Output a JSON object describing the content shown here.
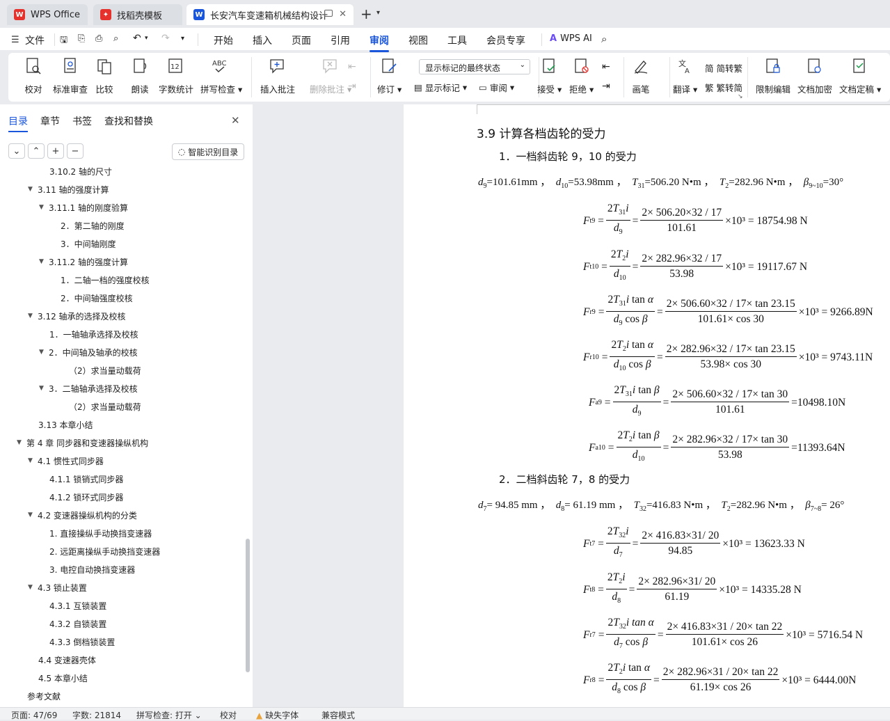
{
  "tabs": [
    {
      "label": "WPS Office",
      "active": false
    },
    {
      "label": "找稻壳模板",
      "active": false
    },
    {
      "label": "长安汽车变速箱机械结构设计",
      "active": true
    }
  ],
  "menu": {
    "file": "文件",
    "items": [
      "开始",
      "插入",
      "页面",
      "引用",
      "审阅",
      "视图",
      "工具",
      "会员专享"
    ],
    "active": "审阅",
    "wps_ai": "WPS AI"
  },
  "ribbon": {
    "proof": "校对",
    "std_review": "标准审查",
    "compare": "比较",
    "read_aloud": "朗读",
    "word_count": "字数统计",
    "spell_check": "拼写检查",
    "insert_comment": "插入批注",
    "delete_comment": "删除批注",
    "track": "修订",
    "display_dropdown": "显示标记的最终状态",
    "show_markup": "显示标记",
    "review": "审阅",
    "accept": "接受",
    "reject": "拒绝",
    "pen": "画笔",
    "translate": "翻译",
    "to_trad": "简转繁",
    "to_simp": "繁转简",
    "restrict": "限制编辑",
    "encrypt": "文档加密",
    "finalize": "文档定稿"
  },
  "sidebar": {
    "tabs": [
      "目录",
      "章节",
      "书签",
      "查找和替换"
    ],
    "active": "目录",
    "ai_toc": "智能识别目录",
    "toc": [
      {
        "t": "3.10.2 轴的尺寸",
        "lvl": 3,
        "caret": ""
      },
      {
        "t": "3.11 轴的强度计算",
        "lvl": 2,
        "caret": "▼"
      },
      {
        "t": "3.11.1 轴的刚度验算",
        "lvl": 3,
        "caret": "▼"
      },
      {
        "t": "2．第二轴的刚度",
        "lvl": 4,
        "caret": ""
      },
      {
        "t": "3．中间轴刚度",
        "lvl": 4,
        "caret": ""
      },
      {
        "t": "3.11.2 轴的强度计算",
        "lvl": 3,
        "caret": "▼"
      },
      {
        "t": "1．二轴一档的强度校核",
        "lvl": 4,
        "caret": ""
      },
      {
        "t": "2．中间轴强度校核",
        "lvl": 4,
        "caret": ""
      },
      {
        "t": "3.12 轴承的选择及校核",
        "lvl": 2,
        "caret": "▼"
      },
      {
        "t": "1．一轴轴承选择及校核",
        "lvl": 3,
        "caret": ""
      },
      {
        "t": "2．中间轴及轴承的校核",
        "lvl": 3,
        "caret": "▼"
      },
      {
        "t": "（2）求当量动载荷",
        "lvl": 5,
        "caret": ""
      },
      {
        "t": "3．二轴轴承选择及校核",
        "lvl": 3,
        "caret": "▼"
      },
      {
        "t": "（2）求当量动载荷",
        "lvl": 5,
        "caret": ""
      },
      {
        "t": "3.13 本章小结",
        "lvl": 2,
        "caret": ""
      },
      {
        "t": "第 4 章  同步器和变速器操纵机构",
        "lvl": 1,
        "caret": "▼"
      },
      {
        "t": "4.1 惯性式同步器",
        "lvl": 2,
        "caret": "▼"
      },
      {
        "t": "4.1.1 锁销式同步器",
        "lvl": 3,
        "caret": ""
      },
      {
        "t": "4.1.2 锁环式同步器",
        "lvl": 3,
        "caret": ""
      },
      {
        "t": "4.2  变速器操纵机构的分类",
        "lvl": 2,
        "caret": "▼"
      },
      {
        "t": "1. 直接操纵手动换挡变速器",
        "lvl": 3,
        "caret": ""
      },
      {
        "t": "2. 远距离操纵手动换挡变速器",
        "lvl": 3,
        "caret": ""
      },
      {
        "t": "3. 电控自动换挡变速器",
        "lvl": 3,
        "caret": ""
      },
      {
        "t": "4.3 锁止装置",
        "lvl": 2,
        "caret": "▼"
      },
      {
        "t": "4.3.1 互锁装置",
        "lvl": 3,
        "caret": ""
      },
      {
        "t": "4.3.2 自锁装置",
        "lvl": 3,
        "caret": ""
      },
      {
        "t": "4.3.3 倒档锁装置",
        "lvl": 3,
        "caret": ""
      },
      {
        "t": "4.4 变速器壳体",
        "lvl": 2,
        "caret": ""
      },
      {
        "t": "4.5 本章小结",
        "lvl": 2,
        "caret": ""
      },
      {
        "t": "参考文献",
        "lvl": 1,
        "caret": ""
      }
    ]
  },
  "doc": {
    "heading": "3.9 计算各档齿轮的受力",
    "s1": "1．一档斜齿轮 9，10 的受力",
    "s2": "2．二档斜齿轮 7，8 的受力",
    "g1": {
      "a": "=101.61mm ，",
      "b": "=53.98mm ，",
      "c": "=506.20 N•m ，",
      "d": "=282.96 N•m ，",
      "e": "=30°"
    },
    "g2": {
      "a": "= 94.85  mm ，",
      "b": "= 61.19  mm ，",
      "c": "=416.83 N•m ，",
      "d": "=282.96 N•m ，",
      "e": "= 26°"
    },
    "eqs": {
      "e1": {
        "num": "2× 506.20×32 / 17",
        "den": "101.61",
        "res": "×10³ = 18754.98 N"
      },
      "e2": {
        "num": "2× 282.96×32 / 17",
        "den": "53.98",
        "res": "×10³ = 19117.67  N"
      },
      "e3": {
        "num": "2× 506.60×32 / 17× tan 23.15",
        "den": "101.61× cos 30",
        "res": "×10³ = 9266.89N"
      },
      "e4": {
        "num": "2× 282.96×32 / 17× tan 23.15",
        "den": "53.98× cos 30",
        "res": "×10³ = 9743.11N"
      },
      "e5": {
        "num": "2× 506.60×32 / 17× tan 30",
        "den": "101.61",
        "res": "=10498.10N"
      },
      "e6": {
        "num": "2× 282.96×32 / 17× tan 30",
        "den": "53.98",
        "res": "=11393.64N"
      },
      "e7": {
        "num": "2× 416.83×31/ 20",
        "den": "94.85",
        "res": "×10³ = 13623.33  N"
      },
      "e8": {
        "num": "2× 282.96×31/ 20",
        "den": "61.19",
        "res": "×10³ = 14335.28  N"
      },
      "e9": {
        "num": "2× 416.83×31 / 20× tan 22",
        "den": "101.61× cos 26",
        "res": "×10³ = 5716.54  N"
      },
      "e10": {
        "num": "2× 282.96×31 / 20× tan 22",
        "den": "61.19× cos 26",
        "res": "×10³ = 6444.00N"
      }
    }
  },
  "status": {
    "page": "页面: 47/69",
    "words": "字数: 21814",
    "spell": "拼写检查: 打开",
    "proof": "校对",
    "missing_font": "缺失字体",
    "compat": "兼容模式"
  }
}
